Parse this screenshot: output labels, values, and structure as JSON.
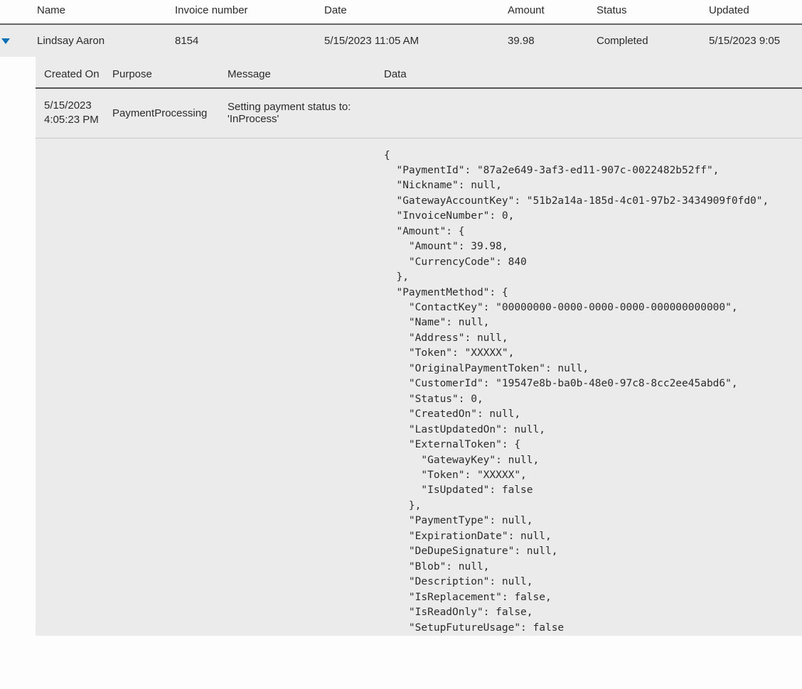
{
  "outer": {
    "headers": {
      "name": "Name",
      "invoice": "Invoice number",
      "date": "Date",
      "amount": "Amount",
      "status": "Status",
      "updated": "Updated"
    },
    "row": {
      "name": "Lindsay Aaron",
      "invoice": "8154",
      "date": "5/15/2023 11:05 AM",
      "amount": "39.98",
      "status": "Completed",
      "updated": "5/15/2023 9:05"
    }
  },
  "detail": {
    "headers": {
      "createdOn": "Created On",
      "purpose": "Purpose",
      "message": "Message",
      "data": "Data"
    },
    "row": {
      "createdOn": "5/15/2023 4:05:23 PM",
      "purpose": "PaymentProcessing",
      "message": "Setting payment status to: 'InProcess'",
      "data": ""
    },
    "json": "{\n  \"PaymentId\": \"87a2e649-3af3-ed11-907c-0022482b52ff\",\n  \"Nickname\": null,\n  \"GatewayAccountKey\": \"51b2a14a-185d-4c01-97b2-3434909f0fd0\",\n  \"InvoiceNumber\": 0,\n  \"Amount\": {\n    \"Amount\": 39.98,\n    \"CurrencyCode\": 840\n  },\n  \"PaymentMethod\": {\n    \"ContactKey\": \"00000000-0000-0000-0000-000000000000\",\n    \"Name\": null,\n    \"Address\": null,\n    \"Token\": \"XXXXX\",\n    \"OriginalPaymentToken\": null,\n    \"CustomerId\": \"19547e8b-ba0b-48e0-97c8-8cc2ee45abd6\",\n    \"Status\": 0,\n    \"CreatedOn\": null,\n    \"LastUpdatedOn\": null,\n    \"ExternalToken\": {\n      \"GatewayKey\": null,\n      \"Token\": \"XXXXX\",\n      \"IsUpdated\": false\n    },\n    \"PaymentType\": null,\n    \"ExpirationDate\": null,\n    \"DeDupeSignature\": null,\n    \"Blob\": null,\n    \"Description\": null,\n    \"IsReplacement\": false,\n    \"IsReadOnly\": false,\n    \"SetupFutureUsage\": false"
  }
}
